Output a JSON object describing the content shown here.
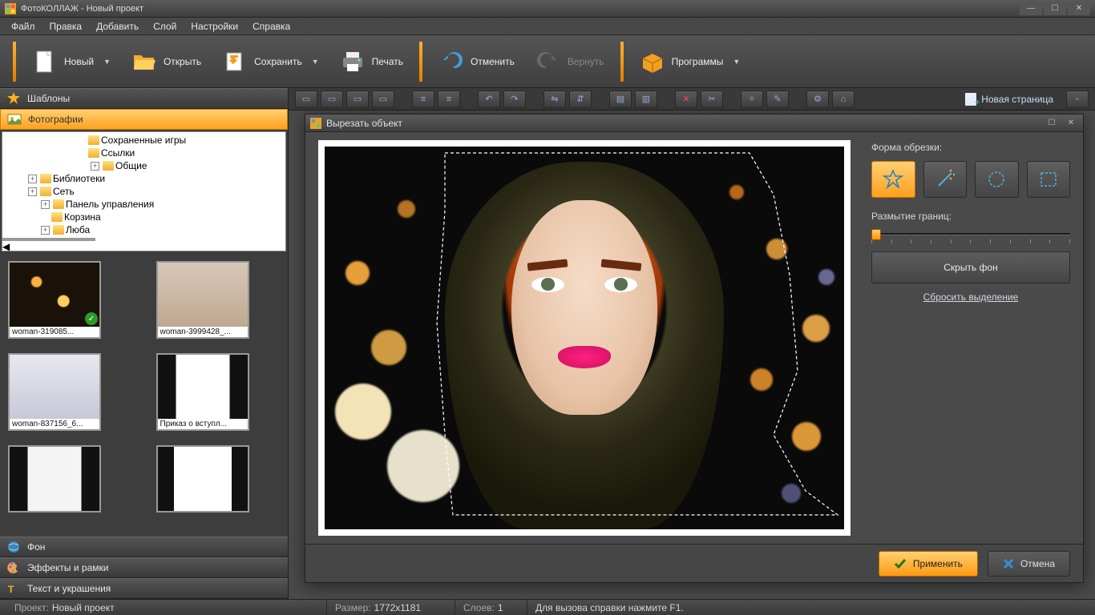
{
  "app": {
    "title": "ФотоКОЛЛАЖ - Новый проект"
  },
  "menu": [
    "Файл",
    "Правка",
    "Добавить",
    "Слой",
    "Настройки",
    "Справка"
  ],
  "toolbar": {
    "new": "Новый",
    "open": "Открыть",
    "save": "Сохранить",
    "print": "Печать",
    "undo": "Отменить",
    "redo": "Вернуть",
    "programs": "Программы"
  },
  "leftPanels": {
    "templates": "Шаблоны",
    "photos": "Фотографии",
    "background": "Фон",
    "effects": "Эффекты и рамки",
    "text": "Текст и украшения"
  },
  "tree": {
    "items": [
      {
        "label": "Сохраненные игры",
        "indent": "indent1"
      },
      {
        "label": "Ссылки",
        "indent": "indent1"
      },
      {
        "label": "Общие",
        "indent": "indent2",
        "exp": "+"
      },
      {
        "label": "Библиотеки",
        "indent": "root0",
        "exp": "+"
      },
      {
        "label": "Сеть",
        "indent": "root0",
        "exp": "+"
      },
      {
        "label": "Панель управления",
        "indent": "root1",
        "exp": "+"
      },
      {
        "label": "Корзина",
        "indent": "root1"
      },
      {
        "label": "Люба",
        "indent": "root1",
        "exp": "+"
      }
    ]
  },
  "thumbs": [
    {
      "caption": "woman-319085...",
      "checked": true
    },
    {
      "caption": "woman-3999428_..."
    },
    {
      "caption": "woman-837156_6..."
    },
    {
      "caption": "Приказ о вступл..."
    },
    {
      "caption": ""
    },
    {
      "caption": ""
    }
  ],
  "iconRow": {
    "newPage": "Новая страница"
  },
  "modal": {
    "title": "Вырезать объект",
    "shapeLabel": "Форма обрезки:",
    "blurLabel": "Размытие границ:",
    "hideBg": "Скрыть фон",
    "reset": "Сбросить выделение",
    "apply": "Применить",
    "cancel": "Отмена"
  },
  "status": {
    "projectLabel": "Проект:",
    "projectValue": "Новый проект",
    "sizeLabel": "Размер:",
    "sizeValue": "1772x1181",
    "layersLabel": "Слоев:",
    "layersValue": "1",
    "help": "Для вызова справки нажмите F1."
  }
}
